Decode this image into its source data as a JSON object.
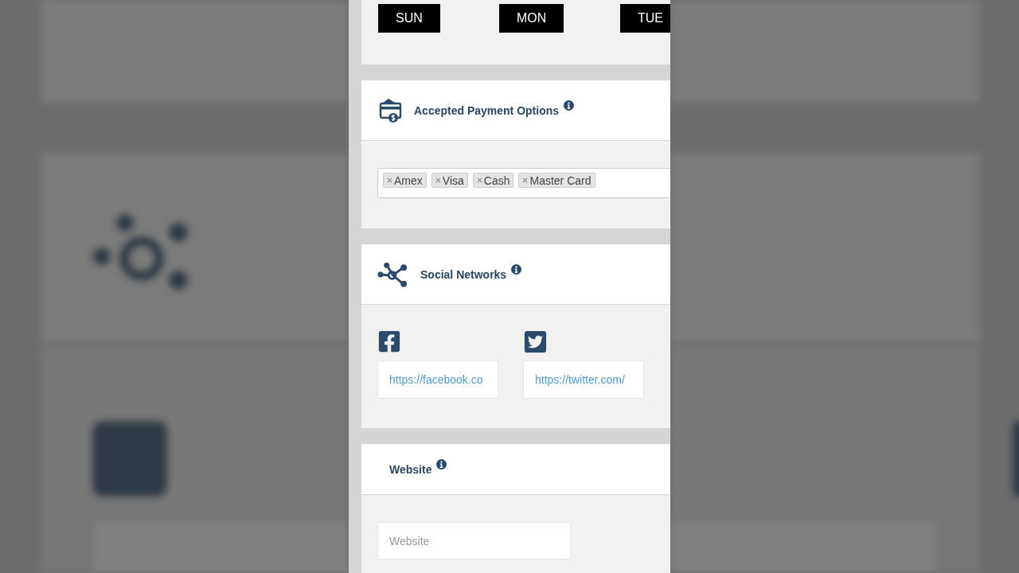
{
  "days": [
    {
      "label": "SUN"
    },
    {
      "label": "MON"
    },
    {
      "label": "TUE"
    }
  ],
  "payment": {
    "title": "Accepted Payment Options",
    "tags": [
      {
        "label": "Amex"
      },
      {
        "label": "Visa"
      },
      {
        "label": "Cash"
      },
      {
        "label": "Master Card"
      }
    ]
  },
  "social": {
    "title": "Social Networks",
    "links": [
      {
        "kind": "facebook",
        "value": "https://facebook.co"
      },
      {
        "kind": "twitter",
        "value": "https://twitter.com/"
      }
    ]
  },
  "website": {
    "title": "Website",
    "placeholder": "Website"
  }
}
